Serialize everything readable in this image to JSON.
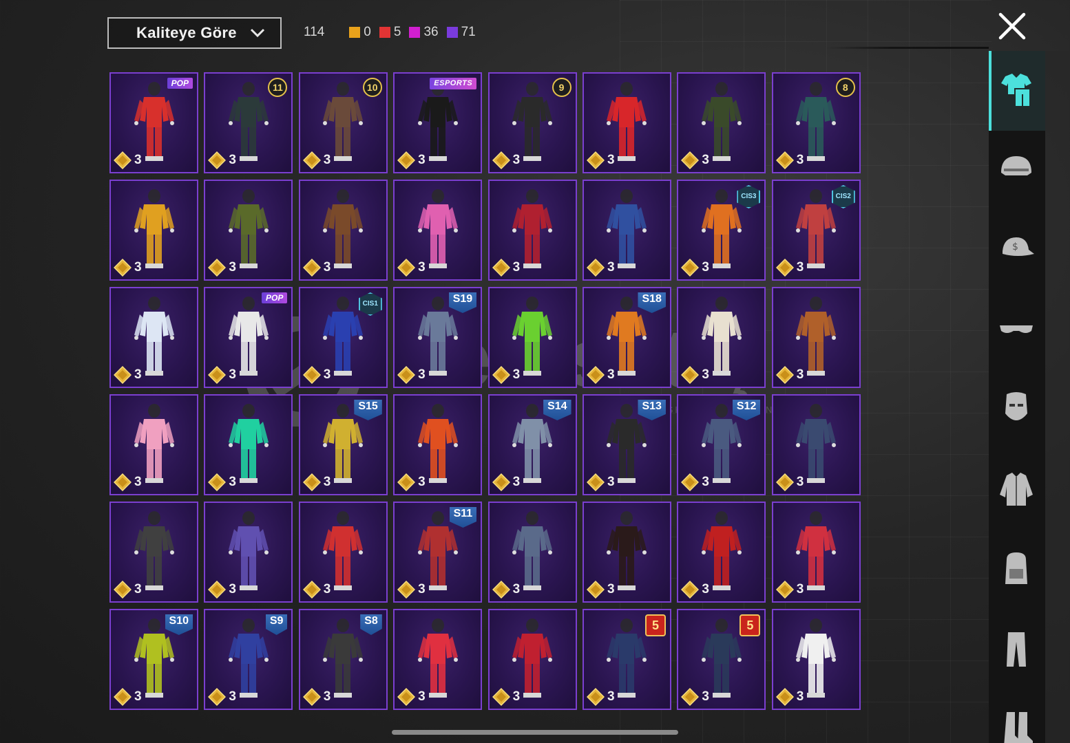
{
  "header": {
    "sort_label": "Kaliteye Göre",
    "total": "114",
    "counts": [
      {
        "value": "0",
        "color": "#e9a21b"
      },
      {
        "value": "5",
        "color": "#e23434"
      },
      {
        "value": "36",
        "color": "#d11fcf"
      },
      {
        "value": "71",
        "color": "#7a3bdc"
      }
    ]
  },
  "watermark": {
    "text": "itemsatış",
    "sub": "HESAP / SKIN / ITEM / PIN",
    "domain": ".com"
  },
  "colors": {
    "card_border": "#7b3fd0",
    "accent": "#4ce0dc",
    "coin": "#e6b53a"
  },
  "items": [
    {
      "qty": "3",
      "badge": "POP",
      "badge_type": "tag",
      "color": "#d8302c"
    },
    {
      "qty": "3",
      "badge": "11",
      "badge_type": "num",
      "color": "#2b3a3a"
    },
    {
      "qty": "3",
      "badge": "10",
      "badge_type": "num",
      "color": "#6a4a3a"
    },
    {
      "qty": "3",
      "badge": "ESPORTS",
      "badge_type": "esports",
      "color": "#1a1a1a"
    },
    {
      "qty": "3",
      "badge": "9",
      "badge_type": "num",
      "color": "#2a2a2a"
    },
    {
      "qty": "3",
      "badge": "",
      "badge_type": "",
      "color": "#d8262a"
    },
    {
      "qty": "3",
      "badge": "",
      "badge_type": "",
      "color": "#3a4a2a"
    },
    {
      "qty": "3",
      "badge": "8",
      "badge_type": "num",
      "color": "#2a5a5a"
    },
    {
      "qty": "3",
      "badge": "",
      "badge_type": "",
      "color": "#e0a020"
    },
    {
      "qty": "3",
      "badge": "",
      "badge_type": "",
      "color": "#5a6a2a"
    },
    {
      "qty": "3",
      "badge": "",
      "badge_type": "",
      "color": "#7a4a2a"
    },
    {
      "qty": "3",
      "badge": "",
      "badge_type": "",
      "color": "#e060b0"
    },
    {
      "qty": "3",
      "badge": "",
      "badge_type": "",
      "color": "#b02030"
    },
    {
      "qty": "3",
      "badge": "",
      "badge_type": "",
      "color": "#3050a0"
    },
    {
      "qty": "3",
      "badge": "CIS3",
      "badge_type": "cis",
      "color": "#e07020"
    },
    {
      "qty": "3",
      "badge": "CIS2",
      "badge_type": "cis",
      "color": "#c04040"
    },
    {
      "qty": "3",
      "badge": "",
      "badge_type": "",
      "color": "#dde6f4"
    },
    {
      "qty": "3",
      "badge": "POP",
      "badge_type": "tag",
      "color": "#e8e8e8"
    },
    {
      "qty": "3",
      "badge": "CIS1",
      "badge_type": "cis",
      "color": "#2a40b0"
    },
    {
      "qty": "3",
      "badge": "S19",
      "badge_type": "season",
      "color": "#6a7a9a"
    },
    {
      "qty": "3",
      "badge": "",
      "badge_type": "",
      "color": "#6ad030"
    },
    {
      "qty": "3",
      "badge": "S18",
      "badge_type": "season",
      "color": "#e07a20"
    },
    {
      "qty": "3",
      "badge": "",
      "badge_type": "",
      "color": "#e8e0d0"
    },
    {
      "qty": "3",
      "badge": "",
      "badge_type": "",
      "color": "#b0602a"
    },
    {
      "qty": "3",
      "badge": "",
      "badge_type": "",
      "color": "#f0a0c0"
    },
    {
      "qty": "3",
      "badge": "",
      "badge_type": "",
      "color": "#20d0a0"
    },
    {
      "qty": "3",
      "badge": "S15",
      "badge_type": "season",
      "color": "#d0b030"
    },
    {
      "qty": "3",
      "badge": "",
      "badge_type": "",
      "color": "#e05020"
    },
    {
      "qty": "3",
      "badge": "S14",
      "badge_type": "season",
      "color": "#8090a8"
    },
    {
      "qty": "3",
      "badge": "S13",
      "badge_type": "season",
      "color": "#2a2a2a"
    },
    {
      "qty": "3",
      "badge": "S12",
      "badge_type": "season",
      "color": "#4a5a80"
    },
    {
      "qty": "3",
      "badge": "",
      "badge_type": "",
      "color": "#3a4a70"
    },
    {
      "qty": "3",
      "badge": "",
      "badge_type": "",
      "color": "#404040"
    },
    {
      "qty": "3",
      "badge": "",
      "badge_type": "",
      "color": "#6050b0"
    },
    {
      "qty": "3",
      "badge": "",
      "badge_type": "",
      "color": "#d03030"
    },
    {
      "qty": "3",
      "badge": "S11",
      "badge_type": "season",
      "color": "#b03030"
    },
    {
      "qty": "3",
      "badge": "",
      "badge_type": "",
      "color": "#5a6a8a"
    },
    {
      "qty": "3",
      "badge": "",
      "badge_type": "",
      "color": "#2a1a1a"
    },
    {
      "qty": "3",
      "badge": "",
      "badge_type": "",
      "color": "#c02020"
    },
    {
      "qty": "3",
      "badge": "",
      "badge_type": "",
      "color": "#d03040"
    },
    {
      "qty": "3",
      "badge": "S10",
      "badge_type": "season",
      "color": "#b0c020"
    },
    {
      "qty": "3",
      "badge": "S9",
      "badge_type": "season",
      "color": "#3040a0"
    },
    {
      "qty": "3",
      "badge": "S8",
      "badge_type": "season",
      "color": "#3a3a3a"
    },
    {
      "qty": "3",
      "badge": "",
      "badge_type": "",
      "color": "#e03040"
    },
    {
      "qty": "3",
      "badge": "",
      "badge_type": "",
      "color": "#c02030"
    },
    {
      "qty": "3",
      "badge": "5",
      "badge_type": "num red",
      "color": "#2a3a6a"
    },
    {
      "qty": "3",
      "badge": "5",
      "badge_type": "num red",
      "color": "#2a3a5a"
    },
    {
      "qty": "3",
      "badge": "",
      "badge_type": "",
      "color": "#f0f0f0"
    }
  ],
  "sidebar": [
    {
      "name": "outfit-category-icon",
      "active": true
    },
    {
      "name": "helmet-category-icon",
      "active": false
    },
    {
      "name": "hat-category-icon",
      "active": false
    },
    {
      "name": "glasses-category-icon",
      "active": false
    },
    {
      "name": "mask-category-icon",
      "active": false
    },
    {
      "name": "jacket-category-icon",
      "active": false
    },
    {
      "name": "backpack-category-icon",
      "active": false
    },
    {
      "name": "pants-category-icon",
      "active": false
    },
    {
      "name": "shoes-category-icon",
      "active": false
    }
  ]
}
